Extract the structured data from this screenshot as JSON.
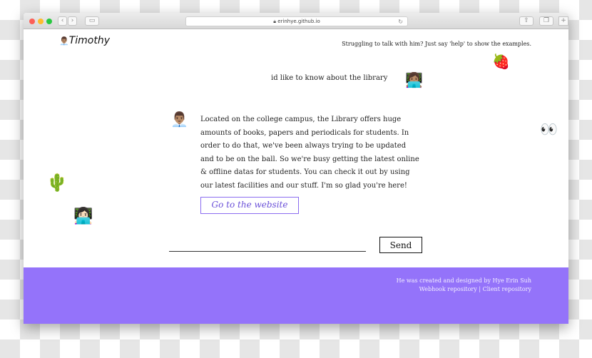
{
  "browser": {
    "url": "erinhye.github.io",
    "tab_plus": "+"
  },
  "header": {
    "logo_emoji": "👨🏽‍💼",
    "title": "Timothy",
    "hint": "Struggling to talk with him? Just say 'help' to show the examples."
  },
  "chat": {
    "user_message": "id like to know about the library",
    "user_avatar": "👩🏽‍💻",
    "bot_avatar": "👨🏽‍💼",
    "bot_message": "Located on the college campus, the Library offers huge amounts of books, papers and periodicals for students. In order to do that, we've been always trying to be updated and to be on the ball. So we're busy getting the latest online & offline datas for students. You can check it out by using our latest facilities and our stuff. I'm so glad you're here!",
    "link_label": "Go to the website"
  },
  "decor": {
    "strawberry": "🍓",
    "eyes": "👀",
    "cactus": "🌵",
    "laptop_person": "👩🏻‍💻"
  },
  "input": {
    "value": "",
    "send_label": "Send"
  },
  "footer": {
    "credit": "He was created and designed by Hye Erin Suh",
    "webhook": "Webhook repository",
    "separator": "|",
    "client": "Client repository"
  },
  "colors": {
    "accent": "#9473fa"
  }
}
